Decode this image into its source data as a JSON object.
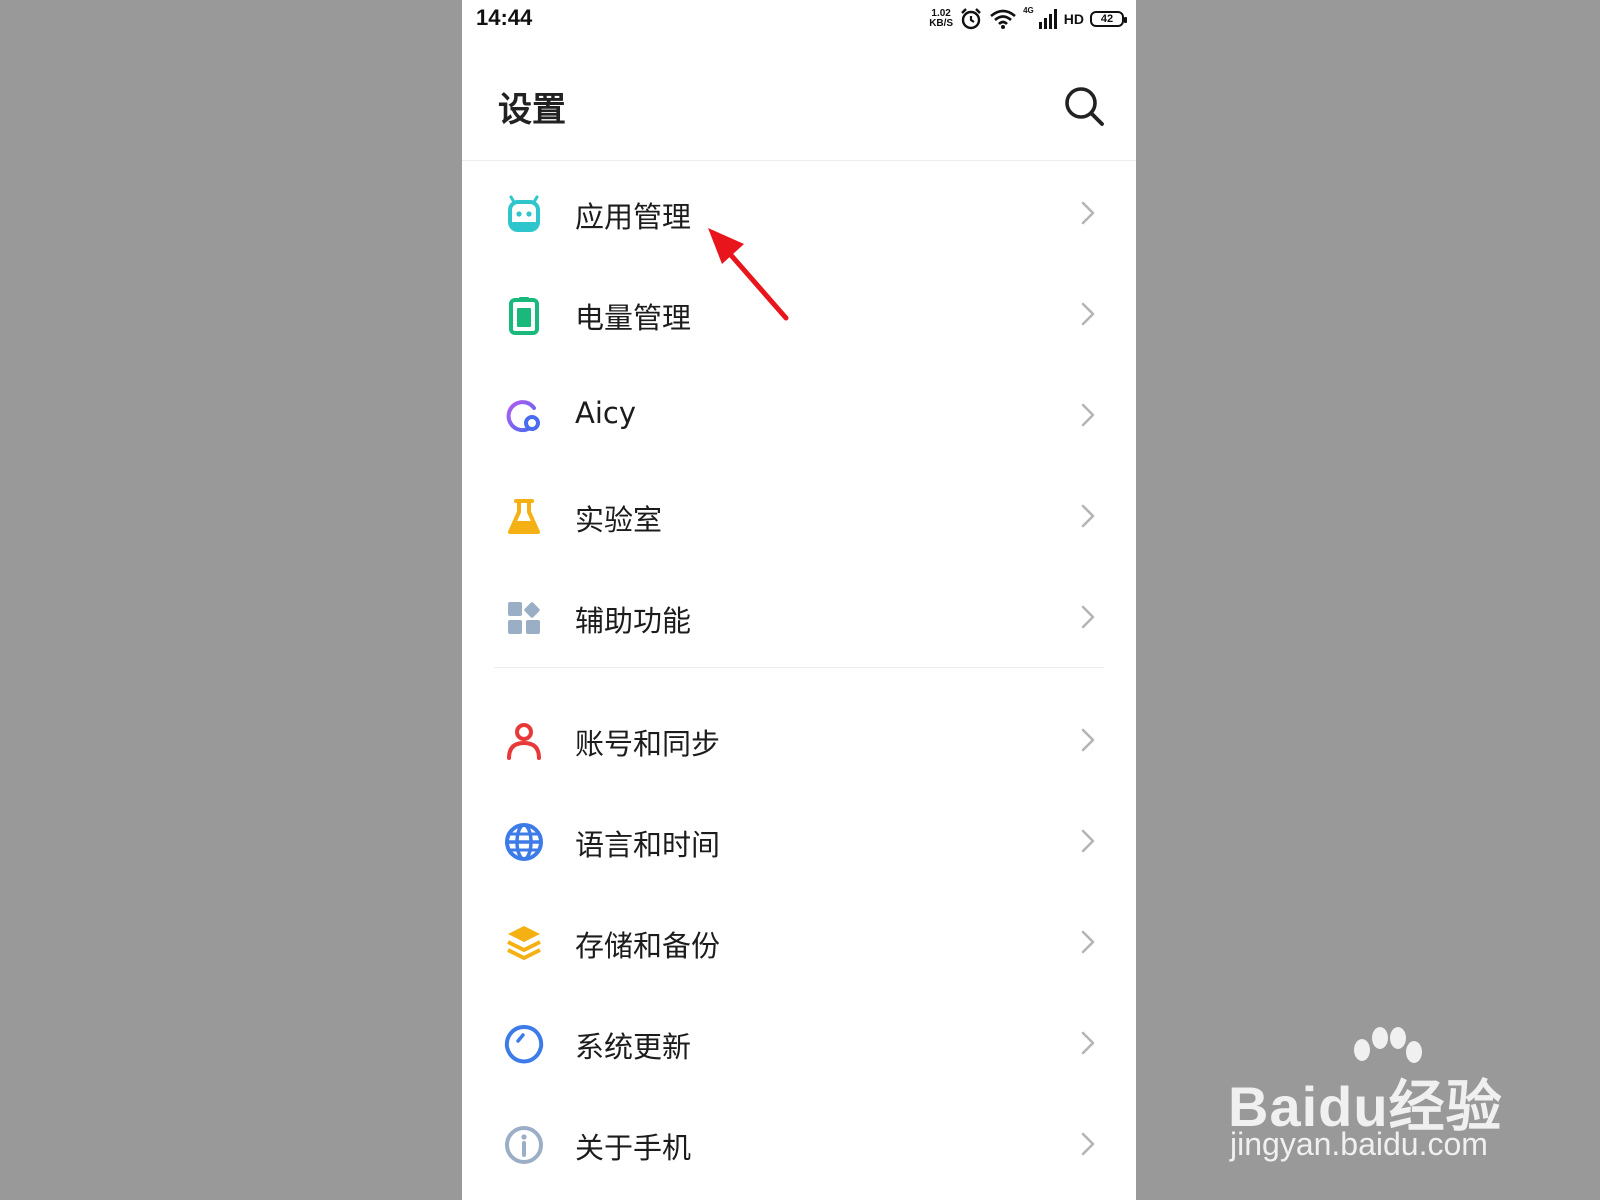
{
  "status_bar": {
    "time": "14:44",
    "net_speed_value": "1.02",
    "net_speed_unit": "KB/S",
    "signal_label": "4G",
    "hd_label": "HD",
    "battery_level": "42"
  },
  "header": {
    "title": "设置"
  },
  "menu_groups": [
    [
      {
        "label": "应用管理",
        "icon": "app-management-icon",
        "color": "#2ec5cc"
      },
      {
        "label": "电量管理",
        "icon": "battery-icon",
        "color": "#19b97c"
      },
      {
        "label": "Aicy",
        "icon": "aicy-icon",
        "color": "#7b5bf0"
      },
      {
        "label": "实验室",
        "icon": "lab-flask-icon",
        "color": "#f5b114"
      },
      {
        "label": "辅助功能",
        "icon": "accessibility-grid-icon",
        "color": "#9aaec6"
      }
    ],
    [
      {
        "label": "账号和同步",
        "icon": "account-person-icon",
        "color": "#e8393a"
      },
      {
        "label": "语言和时间",
        "icon": "globe-icon",
        "color": "#3d7be8"
      },
      {
        "label": "存储和备份",
        "icon": "storage-layers-icon",
        "color": "#f5b114"
      },
      {
        "label": "系统更新",
        "icon": "system-update-icon",
        "color": "#3d7be8"
      },
      {
        "label": "关于手机",
        "icon": "info-icon",
        "color": "#9aaec6"
      }
    ]
  ],
  "annotation": {
    "arrow_color": "#e8161c"
  },
  "watermark": {
    "brand_prefix": "Bai",
    "brand_mid": "du",
    "brand_suffix": "经验",
    "url": "jingyan.baidu.com"
  }
}
